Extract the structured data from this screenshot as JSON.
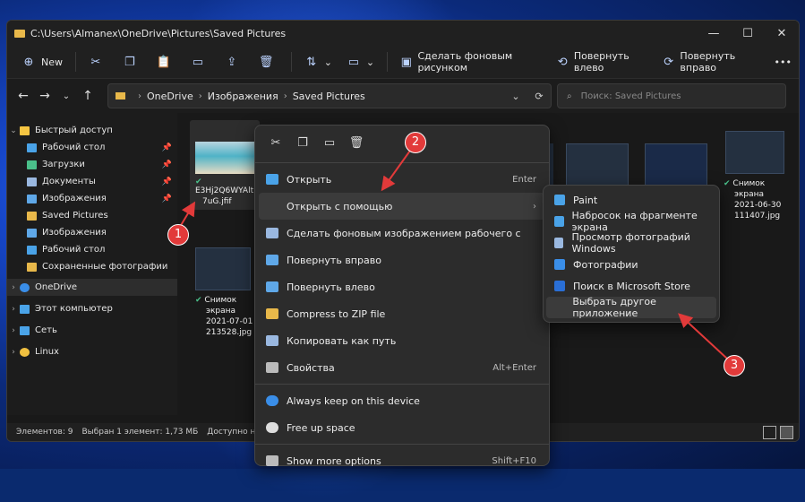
{
  "window": {
    "title": "C:\\Users\\Almanex\\OneDrive\\Pictures\\Saved Pictures"
  },
  "toolbar": {
    "new_label": "New",
    "set_bg_label": "Сделать фоновым рисунком",
    "rotate_left_label": "Повернуть влево",
    "rotate_right_label": "Повернуть вправо",
    "more_label": "•••"
  },
  "address": {
    "crumbs": [
      "OneDrive",
      "Изображения",
      "Saved Pictures"
    ]
  },
  "search": {
    "placeholder": "Поиск: Saved Pictures"
  },
  "sidebar": {
    "items": [
      {
        "label": "Быстрый доступ",
        "icon": "star-icon",
        "color": "#f5c542"
      },
      {
        "label": "Рабочий стол",
        "icon": "desktop-icon",
        "color": "#4aa3e8"
      },
      {
        "label": "Загрузки",
        "icon": "download-icon",
        "color": "#4ac08a"
      },
      {
        "label": "Документы",
        "icon": "document-icon",
        "color": "#9ab8e0"
      },
      {
        "label": "Изображения",
        "icon": "pictures-icon",
        "color": "#5fa8e8"
      },
      {
        "label": "Saved Pictures",
        "icon": "folder-icon",
        "color": "#e8b84a"
      },
      {
        "label": "Изображения",
        "icon": "pictures-icon",
        "color": "#5fa8e8"
      },
      {
        "label": "Рабочий стол",
        "icon": "desktop-icon",
        "color": "#4aa3e8"
      },
      {
        "label": "Сохраненные фотографии",
        "icon": "folder-icon",
        "color": "#e8b84a"
      },
      {
        "label": "OneDrive",
        "icon": "cloud-icon",
        "color": "#3a8ee8"
      },
      {
        "label": "Этот компьютер",
        "icon": "computer-icon",
        "color": "#4aa3e8"
      },
      {
        "label": "Сеть",
        "icon": "network-icon",
        "color": "#4aa3e8"
      },
      {
        "label": "Linux",
        "icon": "linux-icon",
        "color": "#f0c040"
      }
    ]
  },
  "files": [
    {
      "name_line1": "E3Hj2Q6WYAlt",
      "name_line2": "7uG.jfif"
    },
    {
      "name_line1": "Снимок",
      "name_line2": "экрана",
      "name_line3": "2021-07-01",
      "name_line4": "213528.jpg"
    },
    {
      "name_line1": "Снимок",
      "name_line2": "экрана",
      "name_line3": "2021-06-30",
      "name_line4": "111407.jpg"
    }
  ],
  "status": {
    "items_count": "Элементов: 9",
    "selected": "Выбран 1 элемент: 1,73 МБ",
    "availability": "Доступно на это"
  },
  "context_menu": {
    "open": "Открыть",
    "open_accel": "Enter",
    "open_with": "Открыть с помощью",
    "set_bg": "Сделать фоновым изображением рабочего с",
    "rotate_right": "Повернуть вправо",
    "rotate_left": "Повернуть влево",
    "zip": "Compress to ZIP file",
    "copy_path": "Копировать как путь",
    "properties": "Свойства",
    "properties_accel": "Alt+Enter",
    "keep": "Always keep on this device",
    "free": "Free up space",
    "more": "Show more options",
    "more_accel": "Shift+F10"
  },
  "submenu": {
    "items": [
      "Paint",
      "Набросок на фрагменте экрана",
      "Просмотр фотографий Windows",
      "Фотографии",
      "Поиск в Microsoft Store",
      "Выбрать другое приложение"
    ]
  },
  "badges": [
    "1",
    "2",
    "3"
  ],
  "colors": {
    "accent": "#e23a3a",
    "folder": "#e8b84a"
  }
}
